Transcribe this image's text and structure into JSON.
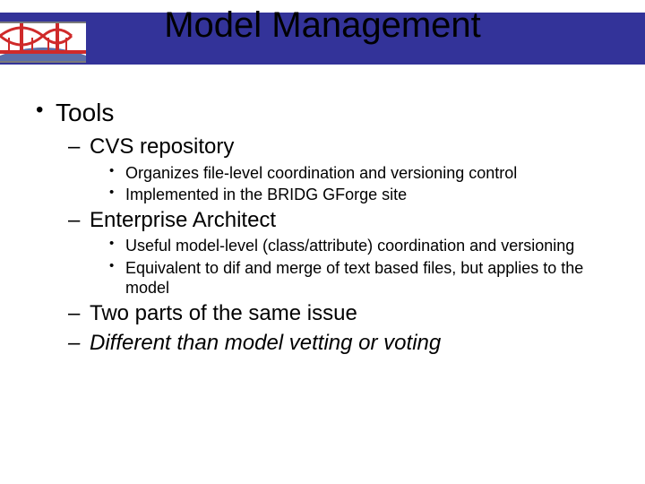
{
  "title": "Model Management",
  "bullets": {
    "l1_0": "Tools",
    "l2_0": "CVS repository",
    "l3_0": "Organizes file-level coordination and versioning control",
    "l3_1": "Implemented in the BRIDG GForge site",
    "l2_1": "Enterprise Architect",
    "l3_2": "Useful model-level (class/attribute) coordination and versioning",
    "l3_3": "Equivalent to dif and merge of text based files, but applies to the model",
    "l2_2": "Two parts of the same issue",
    "l2_3": "Different than model vetting or voting"
  }
}
